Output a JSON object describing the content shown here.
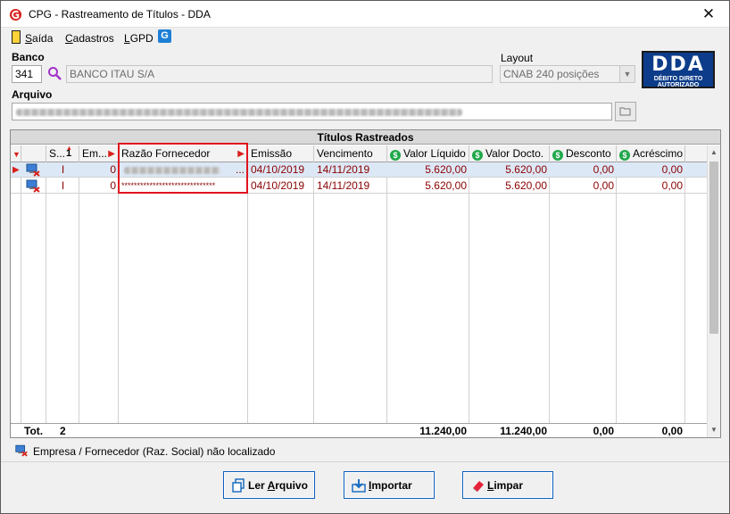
{
  "window": {
    "title": "CPG - Rastreamento de Títulos - DDA",
    "close_label": "✕"
  },
  "menu": {
    "items": [
      {
        "label": "Saída",
        "accel": "S",
        "rest": "aída"
      },
      {
        "label": "Cadastros",
        "accel": "C",
        "rest": "adastros"
      },
      {
        "label": "LGPD",
        "accel": "L",
        "rest": "GPD"
      }
    ]
  },
  "banco": {
    "label": "Banco",
    "code": "341",
    "name": "BANCO ITAU S/A"
  },
  "layout": {
    "label": "Layout",
    "value": "CNAB 240 posições"
  },
  "dda_logo": {
    "big": "DDA",
    "line1": "DÉBITO DIRETO",
    "line2": "AUTORIZADO"
  },
  "arquivo": {
    "label": "Arquivo"
  },
  "grid": {
    "caption": "Títulos Rastreados",
    "columns": [
      "S...",
      "Em...",
      "Razão Fornecedor",
      "Emissão",
      "Vencimento",
      "Valor Líquido",
      "Valor Docto.",
      "Desconto",
      "Acréscimo"
    ],
    "sort_indicator": "1",
    "rows": [
      {
        "s": "I",
        "em": "0",
        "razao": "",
        "emissao": "04/10/2019",
        "vencimento": "14/11/2019",
        "valor_liquido": "5.620,00",
        "valor_docto": "5.620,00",
        "desconto": "0,00",
        "acrescimo": "0,00"
      },
      {
        "s": "I",
        "em": "0",
        "razao": "******************************",
        "emissao": "04/10/2019",
        "vencimento": "14/11/2019",
        "valor_liquido": "5.620,00",
        "valor_docto": "5.620,00",
        "desconto": "0,00",
        "acrescimo": "0,00"
      }
    ],
    "row1_ellipsis": "...",
    "footer": {
      "label": "Tot.",
      "count": "2",
      "valor_liquido": "11.240,00",
      "valor_docto": "11.240,00",
      "desconto": "0,00",
      "acrescimo": "0,00"
    }
  },
  "status": {
    "text": "Empresa / Fornecedor (Raz. Social) não localizado"
  },
  "buttons": {
    "ler_arquivo": {
      "pre": "Ler ",
      "accel": "A",
      "post": "rquivo"
    },
    "importar": {
      "pre": "",
      "accel": "I",
      "post": "mportar"
    },
    "limpar": {
      "pre": "",
      "accel": "L",
      "post": "impar"
    }
  },
  "colors": {
    "accent": "#0b5fbf",
    "error": "#d8211c",
    "row_text": "#8b0000",
    "money": "#1fa84a"
  }
}
